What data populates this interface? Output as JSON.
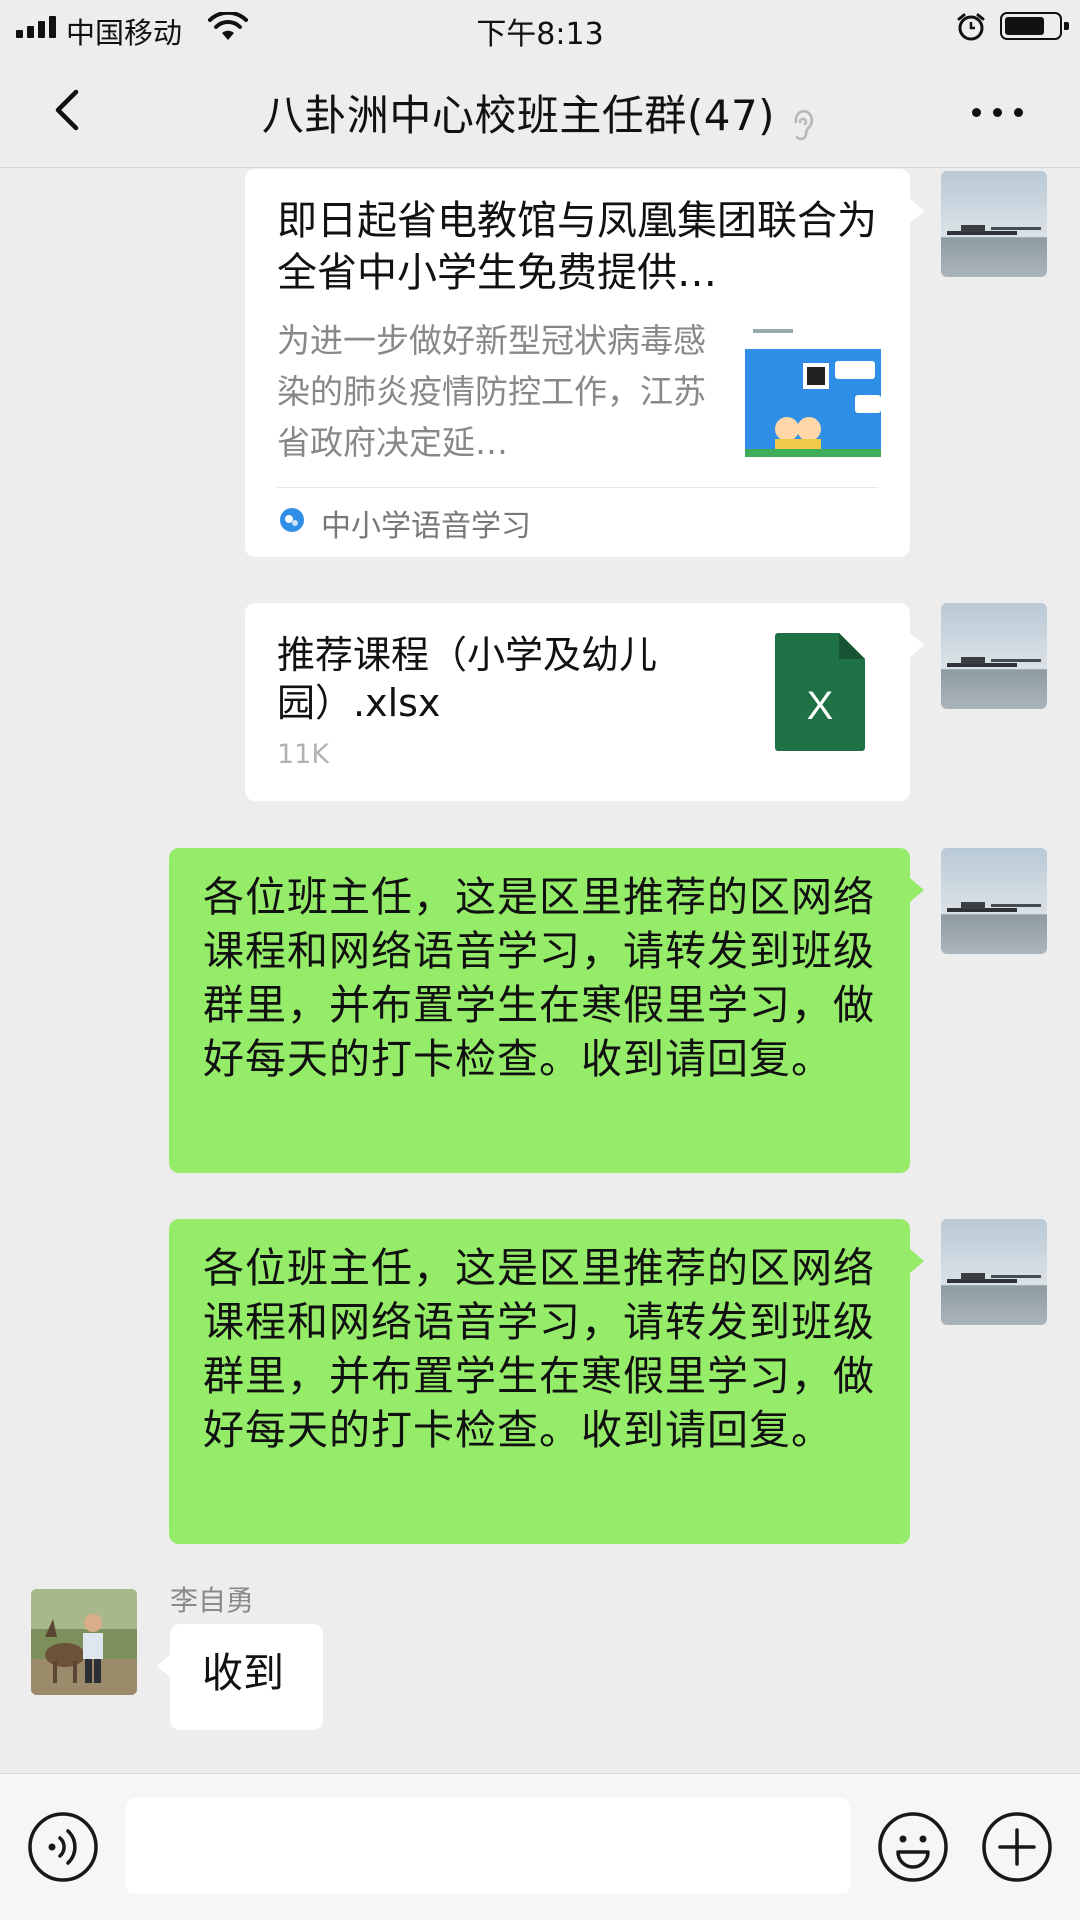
{
  "status_bar": {
    "carrier": "中国移动",
    "time": "下午8:13",
    "battery_level": 0.75
  },
  "nav": {
    "title": "八卦洲中心校班主任群(47)",
    "icons": {
      "back": "chevron-left-icon",
      "mute": "ear-icon",
      "more": "more-dots-icon"
    }
  },
  "messages": [
    {
      "type": "link",
      "from": "self",
      "title": "即日起省电教馆与凤凰集团联合为全省中小学生免费提供…",
      "description": "为进一步做好新型冠状病毒感染的肺炎疫情防控工作，江苏省政府决定延…",
      "source": "中小学语音学习"
    },
    {
      "type": "file",
      "from": "self",
      "file_name": "推荐课程（小学及幼儿园）.xlsx",
      "file_size": "11K",
      "file_icon_letter": "X",
      "file_icon_color": "#1f7245"
    },
    {
      "type": "text",
      "from": "self",
      "text": "各位班主任，这是区里推荐的区网络课程和网络语音学习，请转发到班级群里，并布置学生在寒假里学习，做好每天的打卡检查。收到请回复。"
    },
    {
      "type": "text",
      "from": "self",
      "text": "各位班主任，这是区里推荐的区网络课程和网络语音学习，请转发到班级群里，并布置学生在寒假里学习，做好每天的打卡检查。收到请回复。"
    },
    {
      "type": "text",
      "from": "other",
      "sender": "李自勇",
      "text": "收到"
    }
  ],
  "input_bar": {
    "placeholder": "",
    "icons": {
      "voice": "voice-icon",
      "emoji": "emoji-icon",
      "plus": "plus-icon"
    }
  },
  "colors": {
    "background": "#ededed",
    "self_bubble": "#95ec69",
    "other_bubble": "#ffffff"
  }
}
